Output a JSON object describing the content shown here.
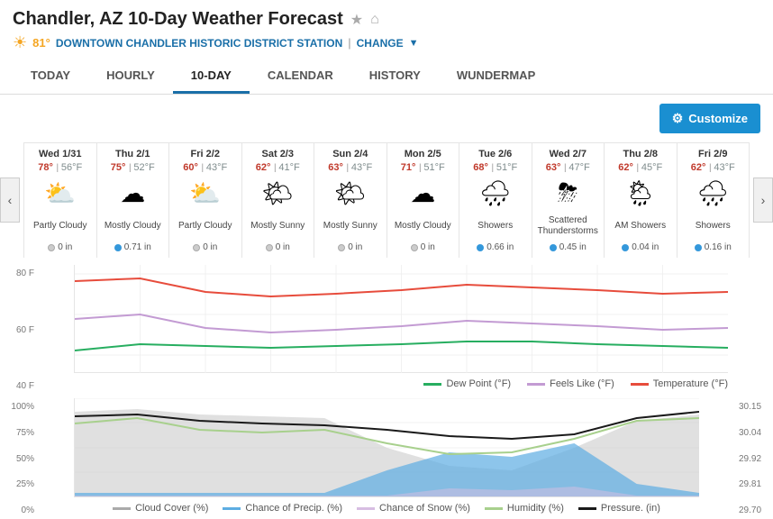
{
  "header": {
    "title": "Chandler, AZ 10-Day Weather Forecast",
    "temp": "81°",
    "station": "DOWNTOWN CHANDLER HISTORIC DISTRICT STATION",
    "change_label": "CHANGE"
  },
  "tabs": [
    {
      "label": "TODAY",
      "active": false
    },
    {
      "label": "HOURLY",
      "active": false
    },
    {
      "label": "10-DAY",
      "active": true
    },
    {
      "label": "CALENDAR",
      "active": false
    },
    {
      "label": "HISTORY",
      "active": false
    },
    {
      "label": "WUNDERMAP",
      "active": false
    }
  ],
  "toolbar": {
    "customize_label": "Customize"
  },
  "forecast": [
    {
      "day": "Wed 1/31",
      "hi": "78°",
      "lo": "56°F",
      "icon": "⛅",
      "condition": "Partly Cloudy",
      "precip": "0 in",
      "precip_type": "gray"
    },
    {
      "day": "Thu 2/1",
      "hi": "75°",
      "lo": "52°F",
      "icon": "⛅",
      "condition": "Mostly Cloudy",
      "precip": "0.71 in",
      "precip_type": "blue"
    },
    {
      "day": "Fri 2/2",
      "hi": "60°",
      "lo": "43°F",
      "icon": "⛅",
      "condition": "Partly Cloudy",
      "precip": "0 in",
      "precip_type": "gray"
    },
    {
      "day": "Sat 2/3",
      "hi": "62°",
      "lo": "41°F",
      "icon": "🌤",
      "condition": "Mostly Sunny",
      "precip": "0 in",
      "precip_type": "gray"
    },
    {
      "day": "Sun 2/4",
      "hi": "63°",
      "lo": "43°F",
      "icon": "🌤",
      "condition": "Mostly Sunny",
      "precip": "0 in",
      "precip_type": "gray"
    },
    {
      "day": "Mon 2/5",
      "hi": "71°",
      "lo": "51°F",
      "icon": "⛅",
      "condition": "Mostly Cloudy",
      "precip": "0 in",
      "precip_type": "gray"
    },
    {
      "day": "Tue 2/6",
      "hi": "68°",
      "lo": "51°F",
      "icon": "🌧",
      "condition": "Showers",
      "precip": "0.66 in",
      "precip_type": "blue"
    },
    {
      "day": "Wed 2/7",
      "hi": "63°",
      "lo": "47°F",
      "icon": "⛈",
      "condition": "Scattered Thunderstorms",
      "precip": "0.45 in",
      "precip_type": "blue"
    },
    {
      "day": "Thu 2/8",
      "hi": "62°",
      "lo": "45°F",
      "icon": "🌧",
      "condition": "AM Showers",
      "precip": "0.04 in",
      "precip_type": "blue"
    },
    {
      "day": "Fri 2/9",
      "hi": "62°",
      "lo": "43°F",
      "icon": "🌧",
      "condition": "Showers",
      "precip": "0.16 in",
      "precip_type": "blue"
    }
  ],
  "temp_chart": {
    "y_labels": [
      "80 F",
      "60 F",
      "40 F"
    ],
    "legend": [
      {
        "label": "Dew Point (°F)",
        "color": "#27ae60"
      },
      {
        "label": "Feels Like (°F)",
        "color": "#c39bd3"
      },
      {
        "label": "Temperature (°F)",
        "color": "#e74c3c"
      }
    ]
  },
  "lower_chart": {
    "y_labels_left": [
      "100%",
      "75%",
      "50%",
      "25%",
      "0%"
    ],
    "y_labels_right": [
      "30.15",
      "30.04",
      "29.92",
      "29.81",
      "29.70"
    ],
    "legend": [
      {
        "label": "Cloud Cover (%)",
        "color": "#aaa"
      },
      {
        "label": "Chance of Precip. (%)",
        "color": "#5dade2"
      },
      {
        "label": "Chance of Snow (%)",
        "color": "#d7bde2"
      },
      {
        "label": "Humidity (%)",
        "color": "#a8d08d"
      },
      {
        "label": "Pressure. (in)",
        "color": "#1a1a1a"
      }
    ]
  }
}
